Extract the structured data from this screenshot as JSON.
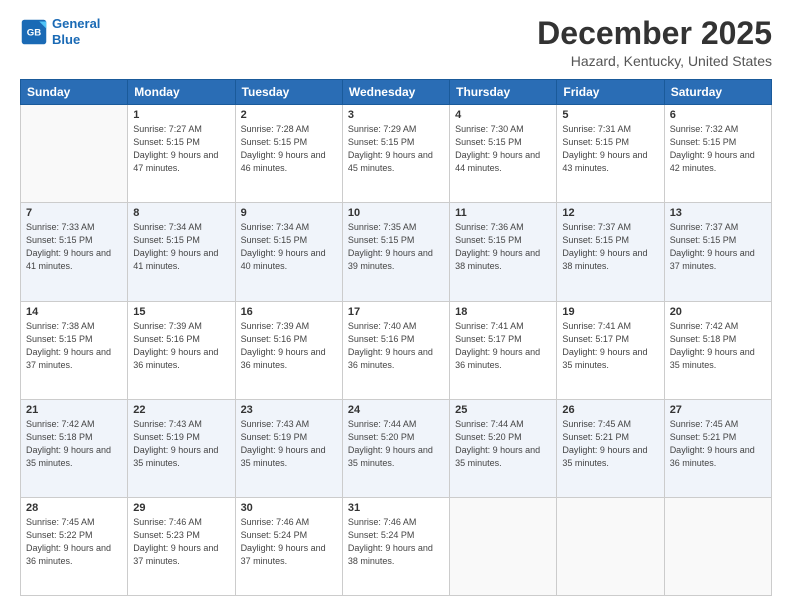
{
  "header": {
    "logo_line1": "General",
    "logo_line2": "Blue",
    "month": "December 2025",
    "location": "Hazard, Kentucky, United States"
  },
  "weekdays": [
    "Sunday",
    "Monday",
    "Tuesday",
    "Wednesday",
    "Thursday",
    "Friday",
    "Saturday"
  ],
  "weeks": [
    [
      {
        "day": "",
        "sunrise": "",
        "sunset": "",
        "daylight": ""
      },
      {
        "day": "1",
        "sunrise": "Sunrise: 7:27 AM",
        "sunset": "Sunset: 5:15 PM",
        "daylight": "Daylight: 9 hours and 47 minutes."
      },
      {
        "day": "2",
        "sunrise": "Sunrise: 7:28 AM",
        "sunset": "Sunset: 5:15 PM",
        "daylight": "Daylight: 9 hours and 46 minutes."
      },
      {
        "day": "3",
        "sunrise": "Sunrise: 7:29 AM",
        "sunset": "Sunset: 5:15 PM",
        "daylight": "Daylight: 9 hours and 45 minutes."
      },
      {
        "day": "4",
        "sunrise": "Sunrise: 7:30 AM",
        "sunset": "Sunset: 5:15 PM",
        "daylight": "Daylight: 9 hours and 44 minutes."
      },
      {
        "day": "5",
        "sunrise": "Sunrise: 7:31 AM",
        "sunset": "Sunset: 5:15 PM",
        "daylight": "Daylight: 9 hours and 43 minutes."
      },
      {
        "day": "6",
        "sunrise": "Sunrise: 7:32 AM",
        "sunset": "Sunset: 5:15 PM",
        "daylight": "Daylight: 9 hours and 42 minutes."
      }
    ],
    [
      {
        "day": "7",
        "sunrise": "Sunrise: 7:33 AM",
        "sunset": "Sunset: 5:15 PM",
        "daylight": "Daylight: 9 hours and 41 minutes."
      },
      {
        "day": "8",
        "sunrise": "Sunrise: 7:34 AM",
        "sunset": "Sunset: 5:15 PM",
        "daylight": "Daylight: 9 hours and 41 minutes."
      },
      {
        "day": "9",
        "sunrise": "Sunrise: 7:34 AM",
        "sunset": "Sunset: 5:15 PM",
        "daylight": "Daylight: 9 hours and 40 minutes."
      },
      {
        "day": "10",
        "sunrise": "Sunrise: 7:35 AM",
        "sunset": "Sunset: 5:15 PM",
        "daylight": "Daylight: 9 hours and 39 minutes."
      },
      {
        "day": "11",
        "sunrise": "Sunrise: 7:36 AM",
        "sunset": "Sunset: 5:15 PM",
        "daylight": "Daylight: 9 hours and 38 minutes."
      },
      {
        "day": "12",
        "sunrise": "Sunrise: 7:37 AM",
        "sunset": "Sunset: 5:15 PM",
        "daylight": "Daylight: 9 hours and 38 minutes."
      },
      {
        "day": "13",
        "sunrise": "Sunrise: 7:37 AM",
        "sunset": "Sunset: 5:15 PM",
        "daylight": "Daylight: 9 hours and 37 minutes."
      }
    ],
    [
      {
        "day": "14",
        "sunrise": "Sunrise: 7:38 AM",
        "sunset": "Sunset: 5:15 PM",
        "daylight": "Daylight: 9 hours and 37 minutes."
      },
      {
        "day": "15",
        "sunrise": "Sunrise: 7:39 AM",
        "sunset": "Sunset: 5:16 PM",
        "daylight": "Daylight: 9 hours and 36 minutes."
      },
      {
        "day": "16",
        "sunrise": "Sunrise: 7:39 AM",
        "sunset": "Sunset: 5:16 PM",
        "daylight": "Daylight: 9 hours and 36 minutes."
      },
      {
        "day": "17",
        "sunrise": "Sunrise: 7:40 AM",
        "sunset": "Sunset: 5:16 PM",
        "daylight": "Daylight: 9 hours and 36 minutes."
      },
      {
        "day": "18",
        "sunrise": "Sunrise: 7:41 AM",
        "sunset": "Sunset: 5:17 PM",
        "daylight": "Daylight: 9 hours and 36 minutes."
      },
      {
        "day": "19",
        "sunrise": "Sunrise: 7:41 AM",
        "sunset": "Sunset: 5:17 PM",
        "daylight": "Daylight: 9 hours and 35 minutes."
      },
      {
        "day": "20",
        "sunrise": "Sunrise: 7:42 AM",
        "sunset": "Sunset: 5:18 PM",
        "daylight": "Daylight: 9 hours and 35 minutes."
      }
    ],
    [
      {
        "day": "21",
        "sunrise": "Sunrise: 7:42 AM",
        "sunset": "Sunset: 5:18 PM",
        "daylight": "Daylight: 9 hours and 35 minutes."
      },
      {
        "day": "22",
        "sunrise": "Sunrise: 7:43 AM",
        "sunset": "Sunset: 5:19 PM",
        "daylight": "Daylight: 9 hours and 35 minutes."
      },
      {
        "day": "23",
        "sunrise": "Sunrise: 7:43 AM",
        "sunset": "Sunset: 5:19 PM",
        "daylight": "Daylight: 9 hours and 35 minutes."
      },
      {
        "day": "24",
        "sunrise": "Sunrise: 7:44 AM",
        "sunset": "Sunset: 5:20 PM",
        "daylight": "Daylight: 9 hours and 35 minutes."
      },
      {
        "day": "25",
        "sunrise": "Sunrise: 7:44 AM",
        "sunset": "Sunset: 5:20 PM",
        "daylight": "Daylight: 9 hours and 35 minutes."
      },
      {
        "day": "26",
        "sunrise": "Sunrise: 7:45 AM",
        "sunset": "Sunset: 5:21 PM",
        "daylight": "Daylight: 9 hours and 35 minutes."
      },
      {
        "day": "27",
        "sunrise": "Sunrise: 7:45 AM",
        "sunset": "Sunset: 5:21 PM",
        "daylight": "Daylight: 9 hours and 36 minutes."
      }
    ],
    [
      {
        "day": "28",
        "sunrise": "Sunrise: 7:45 AM",
        "sunset": "Sunset: 5:22 PM",
        "daylight": "Daylight: 9 hours and 36 minutes."
      },
      {
        "day": "29",
        "sunrise": "Sunrise: 7:46 AM",
        "sunset": "Sunset: 5:23 PM",
        "daylight": "Daylight: 9 hours and 37 minutes."
      },
      {
        "day": "30",
        "sunrise": "Sunrise: 7:46 AM",
        "sunset": "Sunset: 5:24 PM",
        "daylight": "Daylight: 9 hours and 37 minutes."
      },
      {
        "day": "31",
        "sunrise": "Sunrise: 7:46 AM",
        "sunset": "Sunset: 5:24 PM",
        "daylight": "Daylight: 9 hours and 38 minutes."
      },
      {
        "day": "",
        "sunrise": "",
        "sunset": "",
        "daylight": ""
      },
      {
        "day": "",
        "sunrise": "",
        "sunset": "",
        "daylight": ""
      },
      {
        "day": "",
        "sunrise": "",
        "sunset": "",
        "daylight": ""
      }
    ]
  ]
}
